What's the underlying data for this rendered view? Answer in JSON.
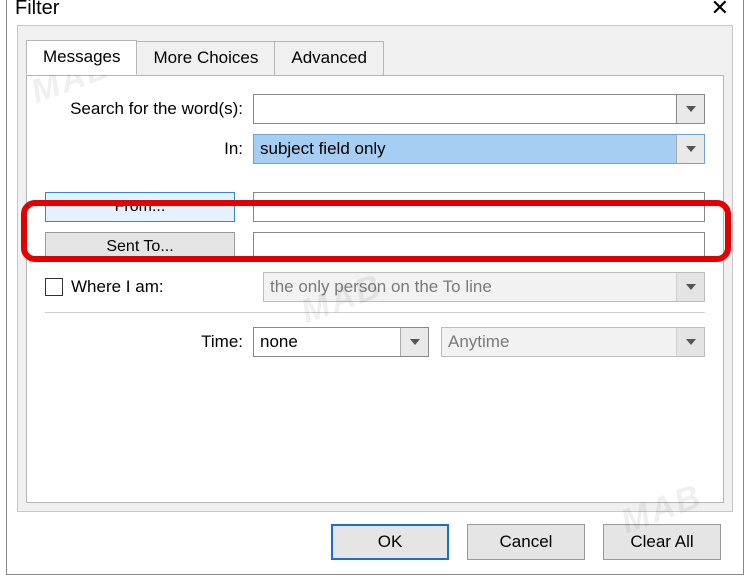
{
  "window": {
    "title": "Filter",
    "close_glyph": "✕"
  },
  "tabs": {
    "messages": "Messages",
    "more_choices": "More Choices",
    "advanced": "Advanced"
  },
  "fields": {
    "search_label": "Search for the word(s):",
    "search_value": "",
    "in_label": "In:",
    "in_value": "subject field only",
    "from_label": "From...",
    "from_value": "",
    "sentto_label": "Sent To...",
    "sentto_value": "",
    "where_label": "Where I am:",
    "where_value": "the only person on the To line",
    "time_label": "Time:",
    "time_value": "none",
    "time_range_value": "Anytime"
  },
  "buttons": {
    "ok": "OK",
    "cancel": "Cancel",
    "clear": "Clear All"
  },
  "watermark": "MAB"
}
